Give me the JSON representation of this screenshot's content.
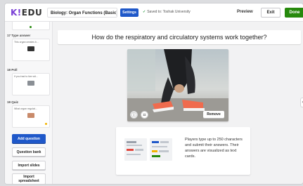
{
  "app": {
    "logo_prefix": "K!",
    "logo_suffix": "EDU"
  },
  "topbar": {
    "kahoot_title": "Biology: Organ Functions (Basic)",
    "settings_label": "Settings",
    "saved_text": "Saved to: Toshak University",
    "preview_label": "Preview",
    "exit_label": "Exit",
    "done_label": "Done"
  },
  "sidebar": {
    "slides": [
      {
        "number": "17",
        "type": "Type answer",
        "question": "This organ creates b..."
      },
      {
        "number": "18",
        "type": "Poll",
        "question": "If you had to live wit..."
      },
      {
        "number": "19",
        "type": "Quiz",
        "question": "What organ regulat..."
      }
    ],
    "buttons": {
      "add_question": "Add question",
      "question_bank": "Question bank",
      "import_slides": "Import slides",
      "import_spreadsheet_line1": "Import",
      "import_spreadsheet_line2": "spreadsheet"
    }
  },
  "main": {
    "question": "How do the respiratory and circulatory systems work together?",
    "media": {
      "remove_label": "Remove",
      "tools": [
        "info-icon",
        "crop-icon"
      ]
    },
    "info_text": "Players type up to 250 characters and submit their answers. Their answers are visualized as text cards."
  },
  "colors": {
    "primary_blue": "#1f58c9",
    "done_green": "#26890c",
    "logo_purple": "#7a3fd6"
  }
}
